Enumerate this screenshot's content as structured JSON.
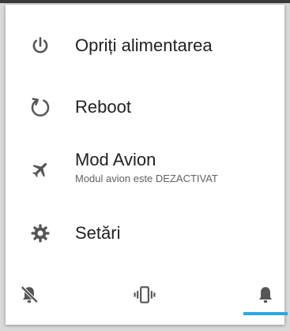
{
  "menu": {
    "items": [
      {
        "label": "Opriți alimentarea",
        "icon": "power-icon"
      },
      {
        "label": "Reboot",
        "icon": "restart-icon"
      },
      {
        "label": "Mod Avion",
        "sublabel": "Modul avion este DEZACTIVAT",
        "icon": "airplane-icon"
      },
      {
        "label": "Setări",
        "icon": "gear-icon"
      }
    ]
  },
  "sound_modes": {
    "items": [
      "silent-bell-off-icon",
      "vibrate-icon",
      "bell-icon"
    ],
    "selected": "bell-icon"
  },
  "colors": {
    "icon": "#555555",
    "text": "#212121",
    "accent": "#29a7e1"
  }
}
